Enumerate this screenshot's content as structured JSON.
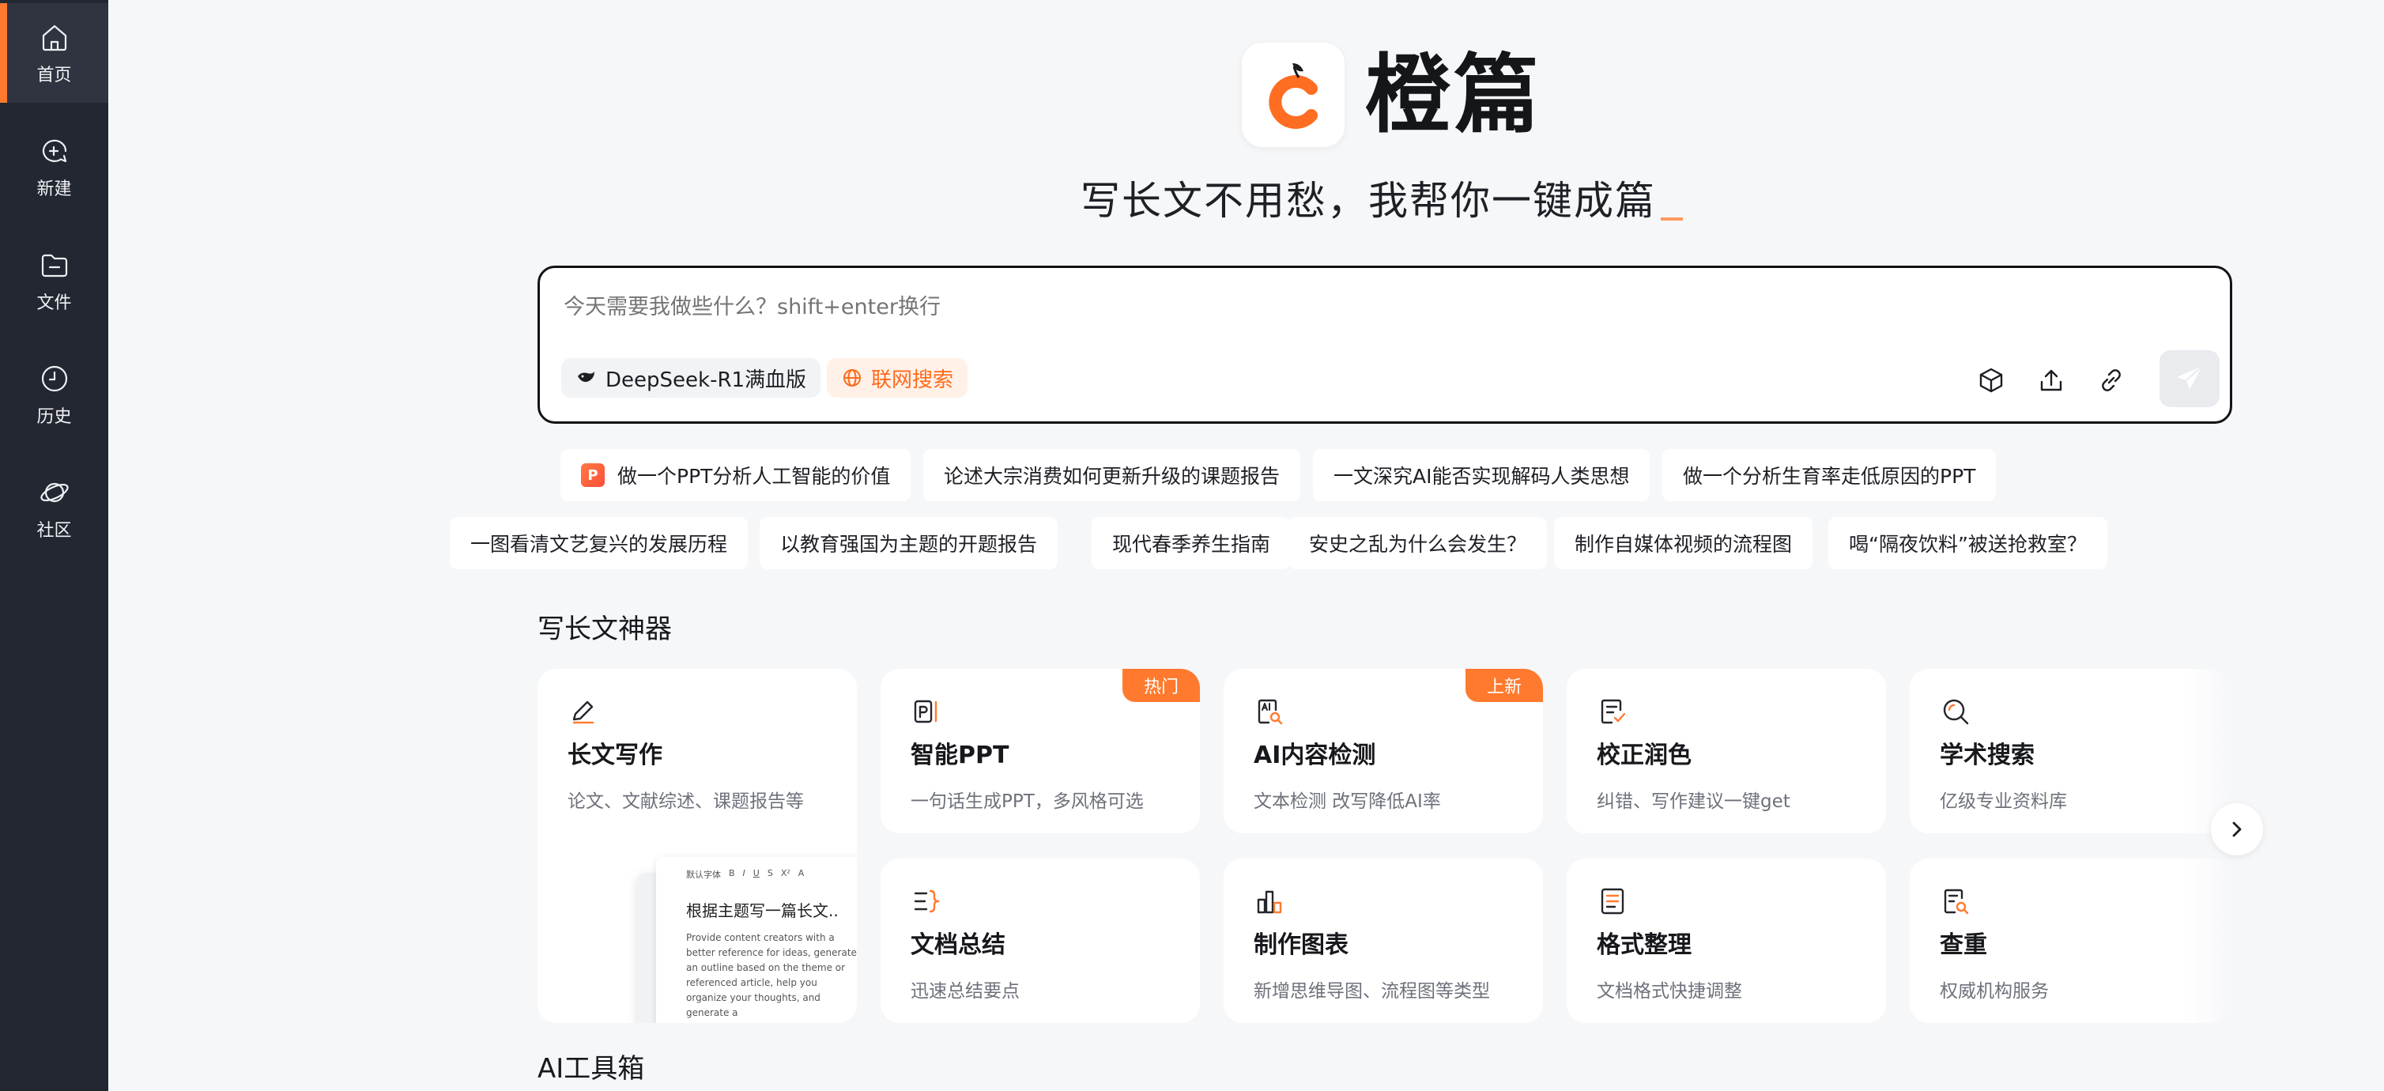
{
  "sidebar": {
    "items": [
      {
        "label": "首页",
        "icon": "home-icon",
        "active": true
      },
      {
        "label": "新建",
        "icon": "new-chat-icon",
        "active": false
      },
      {
        "label": "文件",
        "icon": "folder-icon",
        "active": false
      },
      {
        "label": "历史",
        "icon": "clock-icon",
        "active": false
      },
      {
        "label": "社区",
        "icon": "planet-icon",
        "active": false
      }
    ]
  },
  "brand": {
    "name": "橙篇",
    "slogan": "写长文不用愁，我帮你一键成篇",
    "accent": "#ff7a2e"
  },
  "composer": {
    "placeholder": "今天需要我做些什么？shift+enter换行",
    "model_label": "DeepSeek-R1满血版",
    "search_label": "联网搜索"
  },
  "prompts": {
    "row1": [
      "做一个PPT分析人工智能的价值",
      "论述大宗消费如何更新升级的课题报告",
      "一文深究AI能否实现解码人类思想",
      "做一个分析生育率走低原因的PPT"
    ],
    "row2": [
      "一图看清文艺复兴的发展历程",
      "以教育强国为主题的开题报告",
      "现代春季养生指南",
      "安史之乱为什么会发生？",
      "制作自媒体视频的流程图",
      "喝“隔夜饮料”被送抢救室？"
    ]
  },
  "tools_section": {
    "title": "写长文神器",
    "cards": [
      {
        "title": "长文写作",
        "desc": "论文、文献综述、课题报告等",
        "icon": "pen-icon"
      },
      {
        "title": "智能PPT",
        "desc": "一句话生成PPT，多风格可选",
        "badge": "热门",
        "icon": "ppt-icon"
      },
      {
        "title": "AI内容检测",
        "desc": "文本检测 改写降低AI率",
        "badge": "上新",
        "icon": "ai-detect-icon"
      },
      {
        "title": "校正润色",
        "desc": "纠错、写作建议一键get",
        "icon": "proofread-icon"
      },
      {
        "title": "学术搜索",
        "desc": "亿级专业资料库",
        "icon": "search-icon"
      },
      {
        "title": "文档总结",
        "desc": "迅速总结要点",
        "icon": "summary-icon"
      },
      {
        "title": "制作图表",
        "desc": "新增思维导图、流程图等类型",
        "icon": "chart-icon"
      },
      {
        "title": "格式整理",
        "desc": "文档格式快捷调整",
        "icon": "format-icon"
      },
      {
        "title": "查重",
        "desc": "权威机构服务",
        "icon": "plagiarism-icon"
      }
    ],
    "preview": {
      "toolbar": "默认字体",
      "heading": "根据主题写一篇长文..",
      "body": "Provide content creators with a better reference for ideas, generate an outline based on the theme or referenced article, help you organize your thoughts, and generate a"
    }
  },
  "toolbox_section": {
    "title": "AI工具箱"
  }
}
